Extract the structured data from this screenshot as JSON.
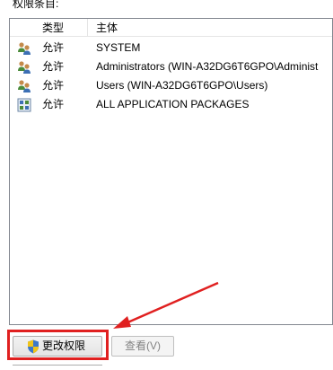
{
  "section_label": "权限条目:",
  "columns": {
    "type": "类型",
    "principal": "主体"
  },
  "entries": [
    {
      "type": "允许",
      "principal": "SYSTEM",
      "icon": "users-group-icon"
    },
    {
      "type": "允许",
      "principal": "Administrators (WIN-A32DG6T6GPO\\Administ",
      "icon": "users-group-icon"
    },
    {
      "type": "允许",
      "principal": "Users (WIN-A32DG6T6GPO\\Users)",
      "icon": "users-group-icon"
    },
    {
      "type": "允许",
      "principal": "ALL APPLICATION PACKAGES",
      "icon": "app-packages-icon"
    }
  ],
  "buttons": {
    "change_permissions": "更改权限",
    "view": "查看(V)"
  },
  "colors": {
    "highlight": "#e02020",
    "list_border": "#828790",
    "disabled_text": "#838383"
  }
}
